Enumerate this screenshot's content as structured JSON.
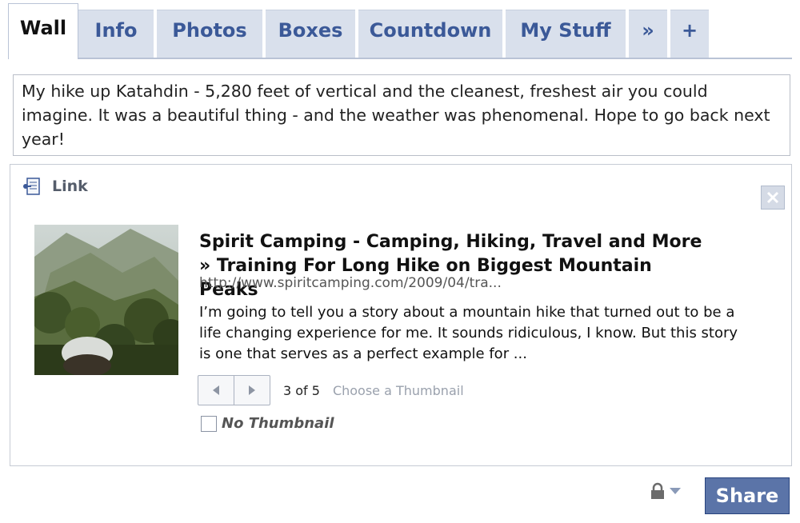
{
  "tabs": [
    {
      "label": "Wall",
      "active": true
    },
    {
      "label": "Info"
    },
    {
      "label": "Photos"
    },
    {
      "label": "Boxes"
    },
    {
      "label": "Countdown"
    },
    {
      "label": "My Stuff"
    },
    {
      "label": "»"
    },
    {
      "label": "+"
    }
  ],
  "status": {
    "text": "My hike up Katahdin - 5,280 feet of vertical and the cleanest, freshest air you could imagine. It was a beautiful thing - and the weather was phenomenal. Hope to go back next year!"
  },
  "link": {
    "header_label": "Link",
    "header_icon": "link-icon",
    "close_icon": "close-icon",
    "title": "Spirit Camping - Camping, Hiking, Travel and More » Training For Long Hike on Biggest Mountain Peaks",
    "url": "http://www.spiritcamping.com/2009/04/tra...",
    "description": "I’m going to tell you a story about a mountain hike that turned out to be a life changing experience for me. It sounds ridiculous, I know. But this story is one that serves as a perfect example for ...",
    "thumbnail_counter": "3 of 5",
    "thumbnail_hint": "Choose a Thumbnail",
    "no_thumbnail_label": "No Thumbnail"
  },
  "footer": {
    "privacy_icon": "lock-icon",
    "share_label": "Share"
  },
  "colors": {
    "tab_text": "#3b5998",
    "tab_bg": "#d9e0ec",
    "share_bg": "#5b74a8"
  }
}
